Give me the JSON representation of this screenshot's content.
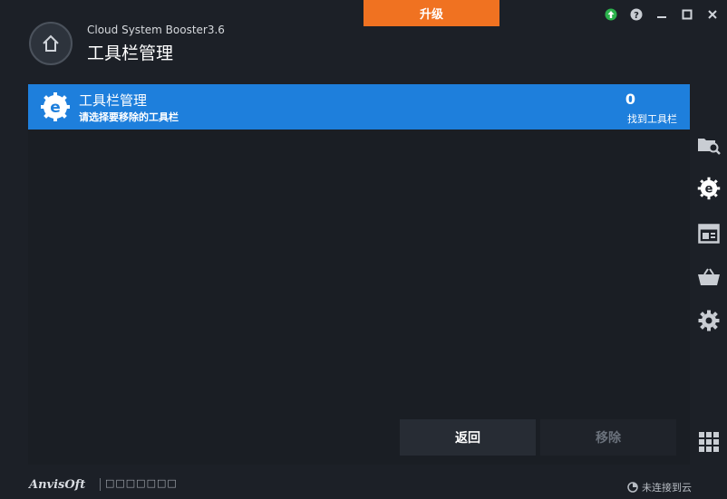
{
  "header": {
    "app_name": "Cloud System Booster3.6",
    "page_title": "工具栏管理",
    "upgrade_label": "升级"
  },
  "window_controls": [
    "update-icon",
    "help-icon",
    "minimize-icon",
    "maximize-icon",
    "close-icon"
  ],
  "banner": {
    "title": "工具栏管理",
    "subtitle": "请选择要移除的工具栏",
    "count": "0",
    "count_label": "找到工具栏"
  },
  "actions": {
    "back_label": "返回",
    "remove_label": "移除"
  },
  "sidebar": {
    "items": [
      "folder-search-icon",
      "ie-gear-icon",
      "browser-window-icon",
      "basket-icon",
      "settings-gear-icon"
    ],
    "grid_icon": "apps-grid-icon"
  },
  "footer": {
    "brand": "AnvisOft",
    "tagline": "□□□□□□□",
    "connection_status": "未连接到云"
  },
  "colors": {
    "accent_blue": "#1e7fdc",
    "upgrade_orange": "#f07221",
    "background": "#1c2027",
    "update_green": "#2bb24c"
  }
}
